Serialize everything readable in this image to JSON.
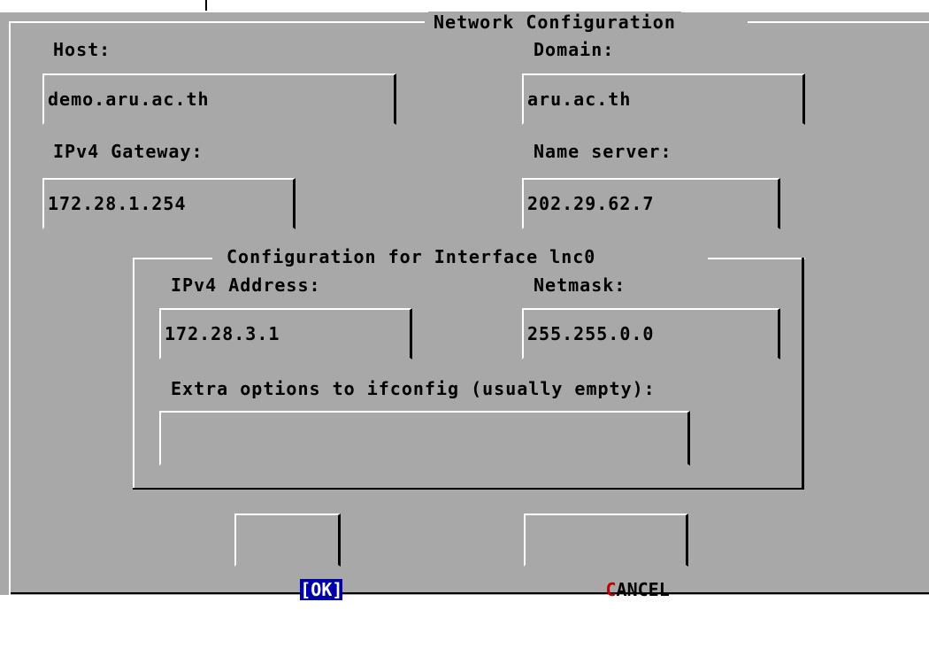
{
  "dialog": {
    "title": "Network Configuration",
    "labels": {
      "host": "Host:",
      "domain": "Domain:",
      "gateway": "IPv4 Gateway:",
      "nameserver": "Name server:"
    },
    "values": {
      "host": "demo.aru.ac.th",
      "domain": "aru.ac.th",
      "gateway": "172.28.1.254",
      "nameserver": "202.29.62.7"
    }
  },
  "interface_group": {
    "title": "Configuration for Interface lnc0",
    "labels": {
      "address": "IPv4 Address:",
      "netmask": "Netmask:",
      "extra": "Extra options to ifconfig (usually empty):"
    },
    "values": {
      "address": "172.28.3.1",
      "netmask": "255.255.0.0",
      "extra": ""
    }
  },
  "buttons": {
    "ok": {
      "open": "[",
      "hotkey": "O",
      "rest": "K",
      "close": "]"
    },
    "cancel": {
      "hotkey": "C",
      "rest": "ANCEL"
    }
  },
  "colors": {
    "background": "#a8a8a8",
    "focus": "#0000aa",
    "hotkey": "#c00000"
  }
}
